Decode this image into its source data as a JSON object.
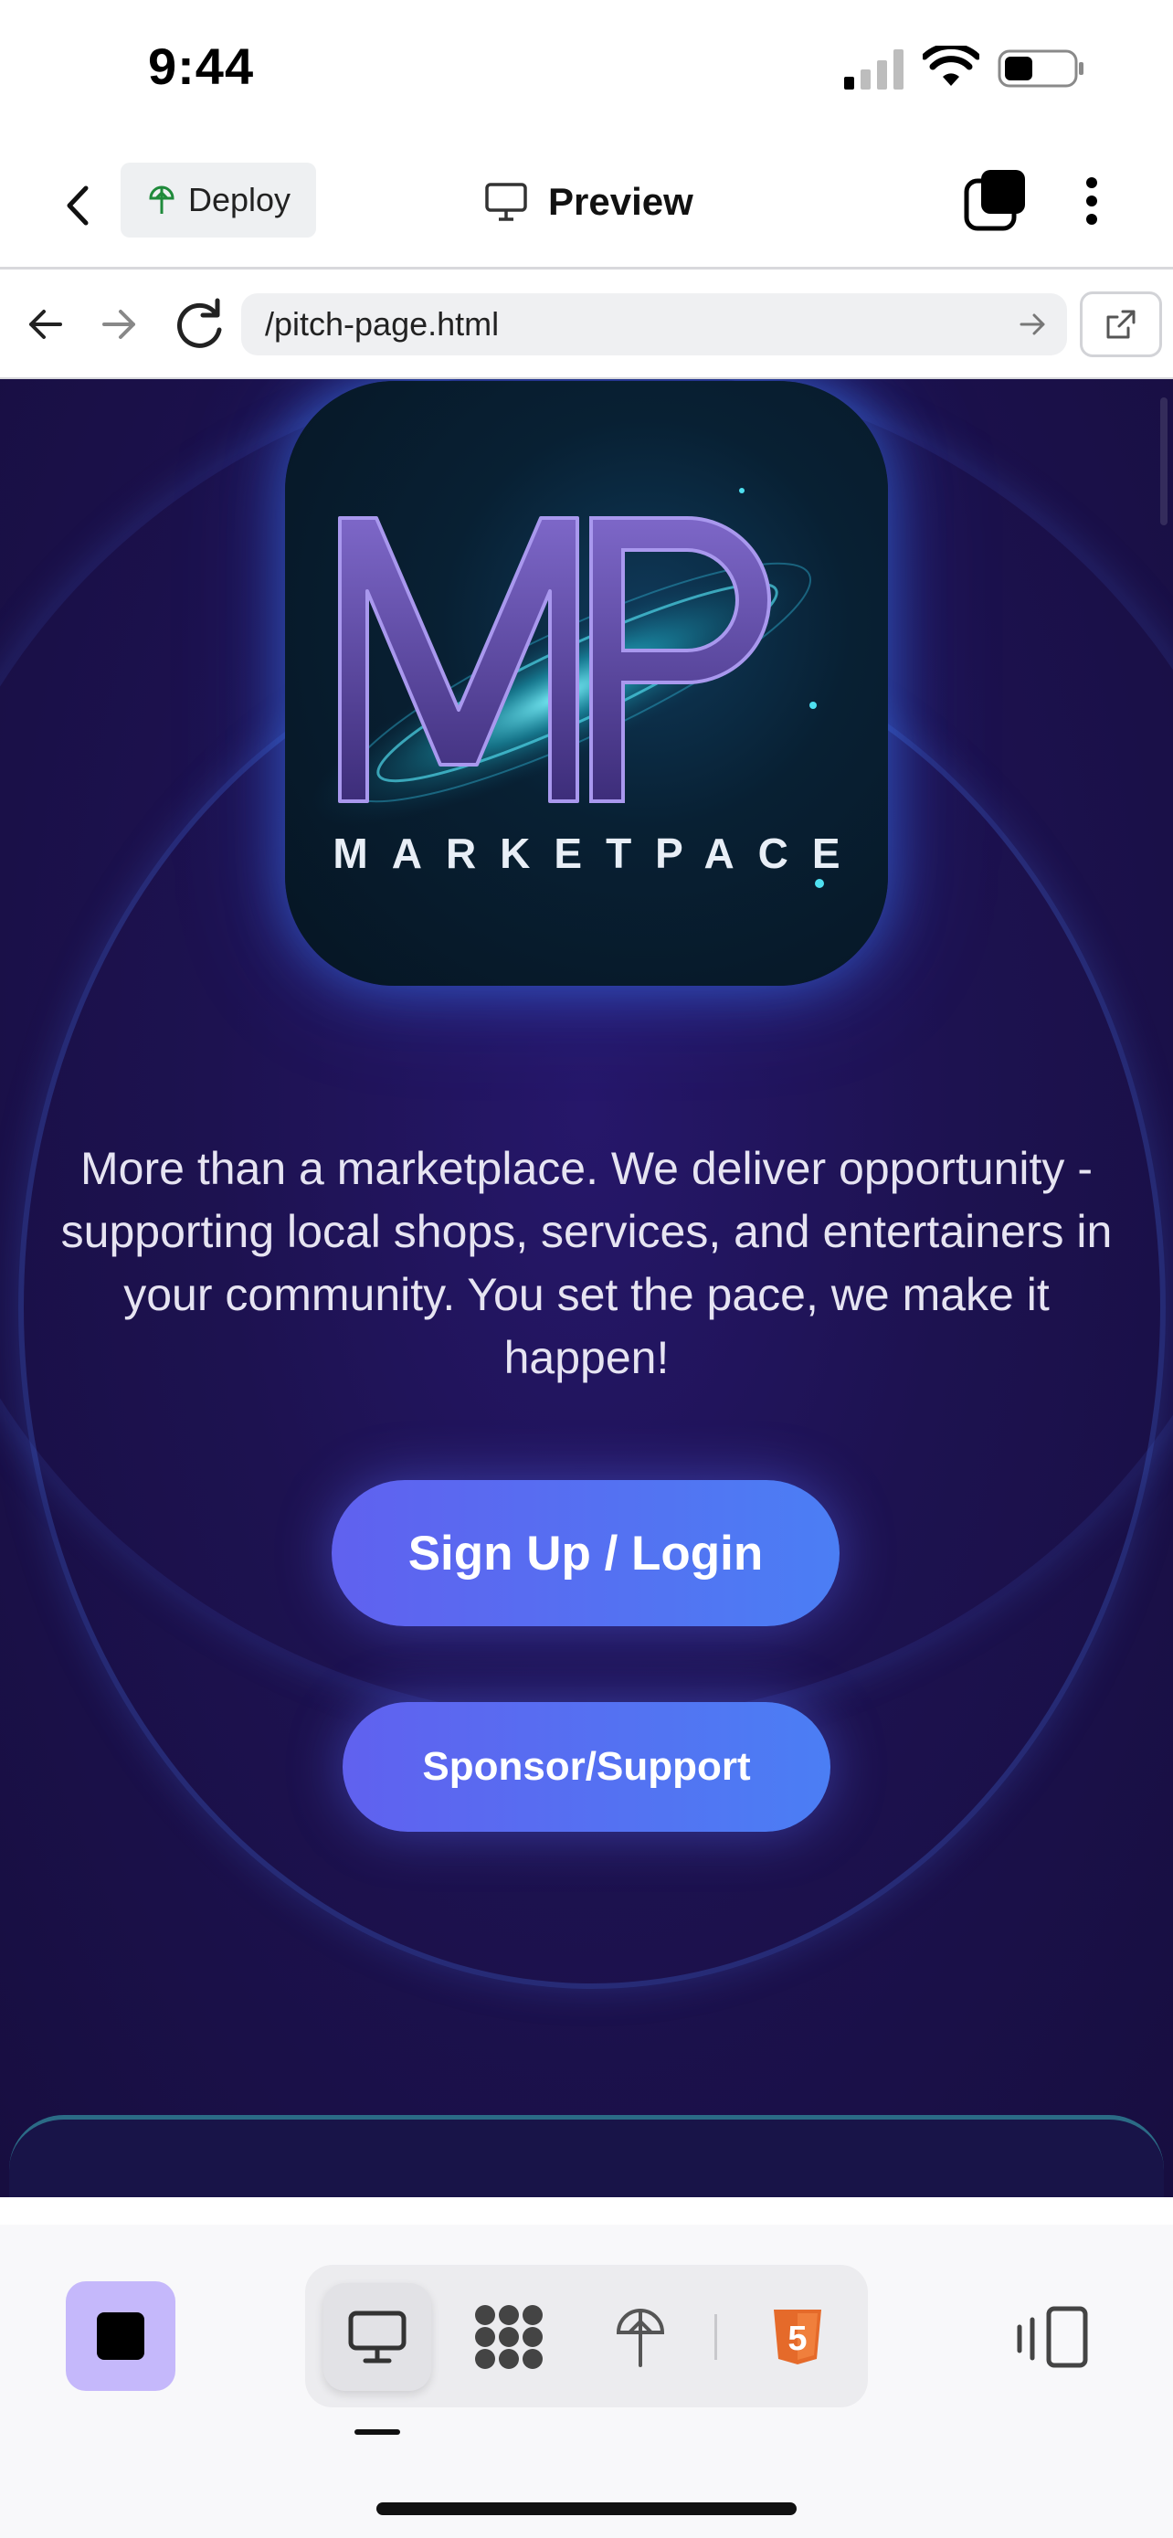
{
  "status_bar": {
    "time": "9:44"
  },
  "header": {
    "deploy_label": "Deploy",
    "title": "Preview"
  },
  "browser": {
    "url": "/pitch-page.html"
  },
  "page": {
    "logo_wordmark": "MARKETPACE",
    "logo_monogram": "MP",
    "tagline": "More than a marketplace. We deliver opportunity - supporting local shops, services, and entertainers in your community. You set the pace, we make it happen!",
    "primary_button": "Sign Up / Login",
    "secondary_button": "Sponsor/Support"
  },
  "toolbar": {
    "views": [
      "desktop-icon",
      "components-icon",
      "deploy-icon",
      "html5-icon"
    ],
    "html5_badge": "5"
  },
  "colors": {
    "accent_purple": "#c5b8fb",
    "page_background": "#1d1250",
    "button_gradient_start": "#6061ef",
    "button_gradient_end": "#4b7ef4",
    "html5_orange": "#e56a2a"
  }
}
